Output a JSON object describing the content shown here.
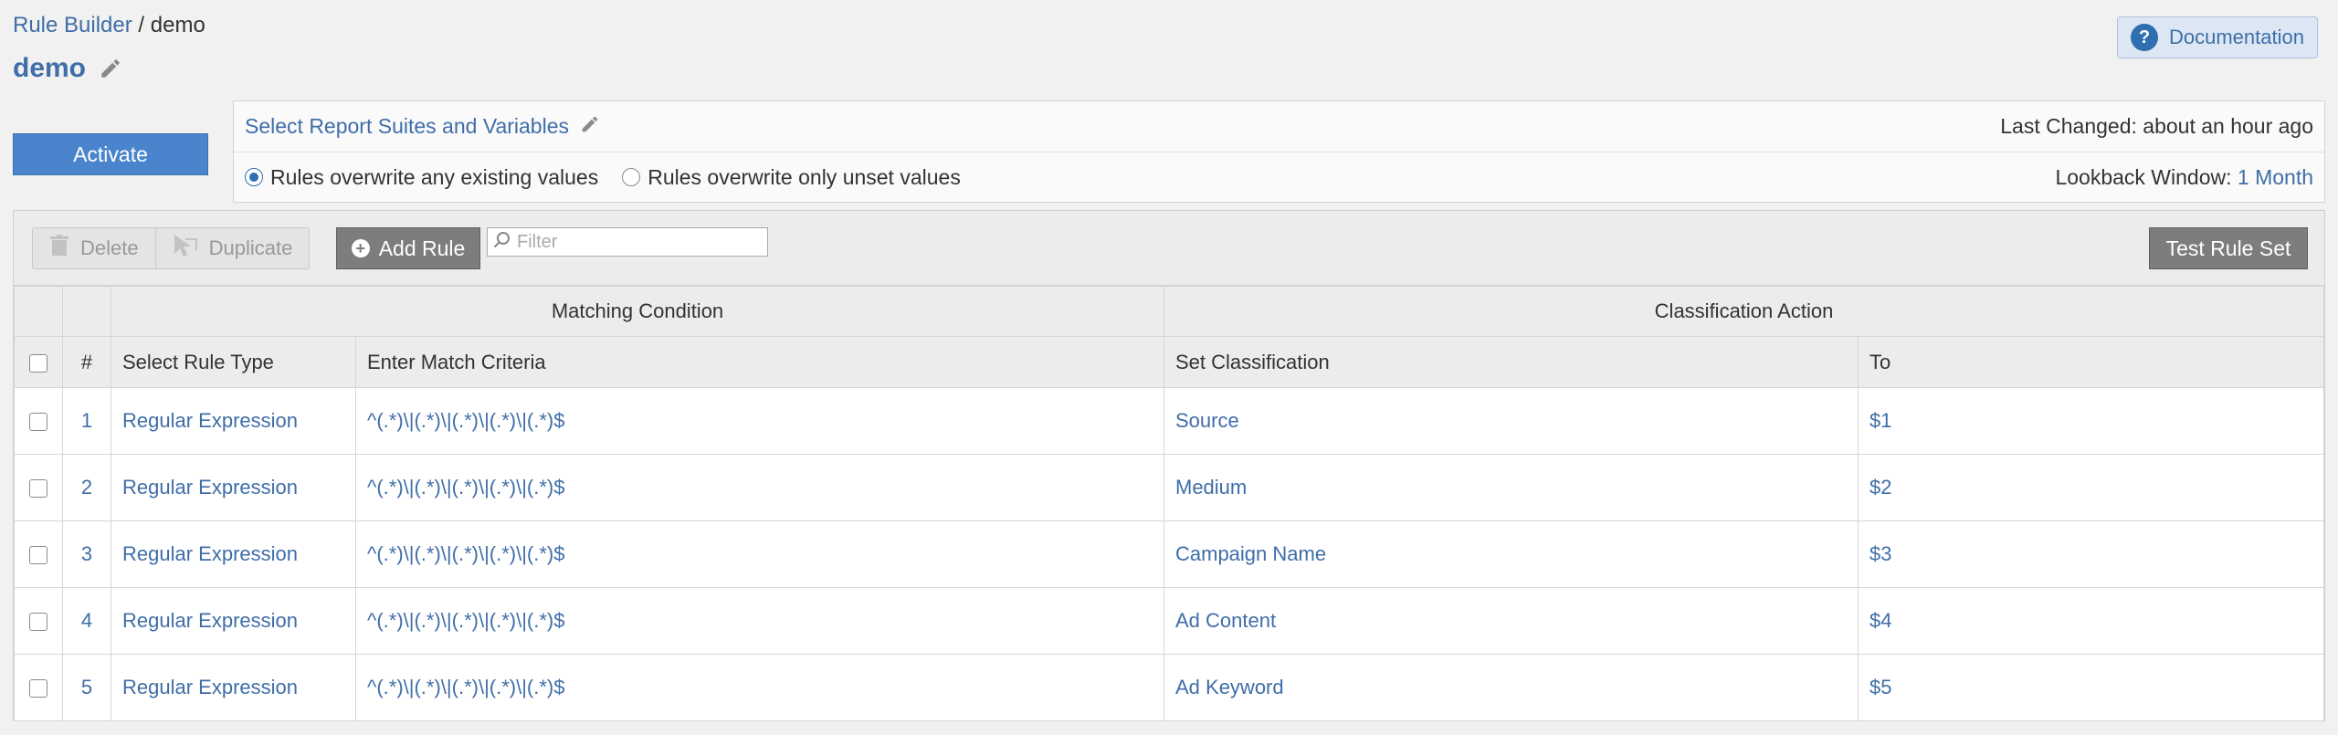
{
  "breadcrumb": {
    "root": "Rule Builder",
    "separator": "/",
    "current": "demo"
  },
  "page": {
    "title": "demo",
    "edit_icon": "pencil-icon"
  },
  "header": {
    "documentation_label": "Documentation",
    "help_icon": "question-circle-icon"
  },
  "activate_label": "Activate",
  "settings": {
    "select_link": "Select Report Suites and Variables",
    "last_changed_label": "Last Changed:",
    "last_changed_value": "about an hour ago",
    "radio_overwrite_any": "Rules overwrite any existing values",
    "radio_overwrite_unset": "Rules overwrite only unset values",
    "selected_radio": "overwrite_any",
    "lookback_label": "Lookback Window:",
    "lookback_value": "1 Month"
  },
  "toolbar": {
    "delete_label": "Delete",
    "duplicate_label": "Duplicate",
    "add_rule_label": "Add Rule",
    "filter_placeholder": "Filter",
    "test_label": "Test Rule Set"
  },
  "table": {
    "group_headers": {
      "matching": "Matching Condition",
      "classification": "Classification Action"
    },
    "columns": {
      "num": "#",
      "rule_type": "Select Rule Type",
      "criteria": "Enter Match Criteria",
      "classification": "Set Classification",
      "to": "To"
    },
    "rows": [
      {
        "num": "1",
        "rule_type": "Regular Expression",
        "criteria": "^(.*)\\|(.*)\\|(.*)\\|(.*)\\|(.*)$",
        "classification": "Source",
        "to": "$1"
      },
      {
        "num": "2",
        "rule_type": "Regular Expression",
        "criteria": "^(.*)\\|(.*)\\|(.*)\\|(.*)\\|(.*)$",
        "classification": "Medium",
        "to": "$2"
      },
      {
        "num": "3",
        "rule_type": "Regular Expression",
        "criteria": "^(.*)\\|(.*)\\|(.*)\\|(.*)\\|(.*)$",
        "classification": "Campaign Name",
        "to": "$3"
      },
      {
        "num": "4",
        "rule_type": "Regular Expression",
        "criteria": "^(.*)\\|(.*)\\|(.*)\\|(.*)\\|(.*)$",
        "classification": "Ad Content",
        "to": "$4"
      },
      {
        "num": "5",
        "rule_type": "Regular Expression",
        "criteria": "^(.*)\\|(.*)\\|(.*)\\|(.*)\\|(.*)$",
        "classification": "Ad Keyword",
        "to": "$5"
      }
    ]
  },
  "colors": {
    "link": "#3f6ea8",
    "primary_button": "#4a84cc",
    "dark_button": "#7d7d7d",
    "background": "#f1f1f1"
  }
}
